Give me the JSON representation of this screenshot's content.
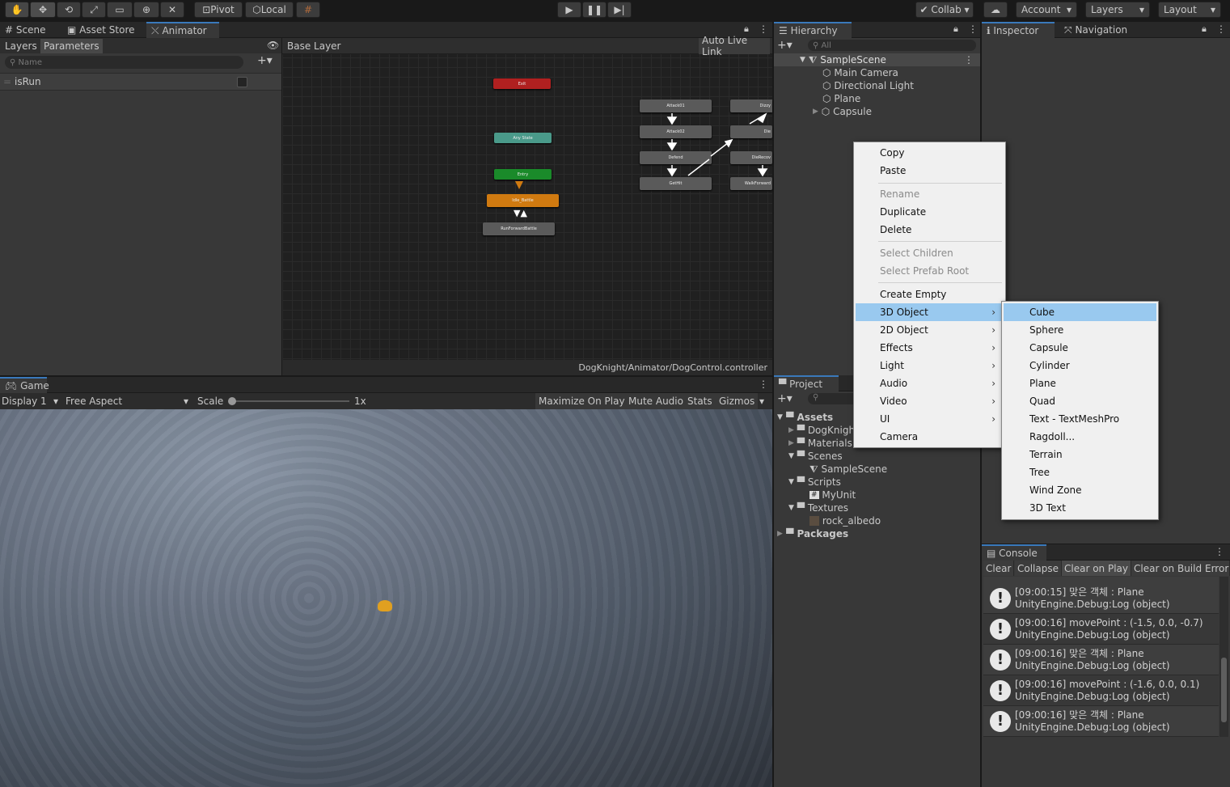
{
  "toolbar": {
    "pivot": "Pivot",
    "local": "Local",
    "collab": "Collab",
    "account": "Account",
    "layers": "Layers",
    "layout": "Layout"
  },
  "tabs_top": {
    "scene": "Scene",
    "asset_store": "Asset Store",
    "animator": "Animator"
  },
  "animator": {
    "sub_tabs": [
      "Layers",
      "Parameters"
    ],
    "name_placeholder": "Name",
    "param": "isRun",
    "breadcrumb": "Base Layer",
    "auto_live_link": "Auto Live Link",
    "path": "DogKnight/Animator/DogControl.controller",
    "nodes": {
      "exit": "Exit",
      "any": "Any State",
      "entry": "Entry",
      "idle": "Idle_Battle",
      "run": "RunForwardBattle",
      "atk1": "Attack01",
      "atk2": "Attack02",
      "defend": "Defend",
      "gethit": "GetHit",
      "dizzy": "Dizzy",
      "die": "Die",
      "dierecover": "DieRecov",
      "walk": "WalkForward"
    }
  },
  "game": {
    "tab": "Game",
    "display": "Display 1",
    "aspect": "Free Aspect",
    "scale_label": "Scale",
    "scale_value": "1x",
    "maximize": "Maximize On Play",
    "mute": "Mute Audio",
    "stats": "Stats",
    "gizmos": "Gizmos"
  },
  "hierarchy": {
    "tab": "Hierarchy",
    "search_placeholder": "All",
    "scene": "SampleScene",
    "items": [
      "Main Camera",
      "Directional Light",
      "Plane",
      "Capsule"
    ]
  },
  "inspector": {
    "tab": "Inspector",
    "nav_tab": "Navigation"
  },
  "project": {
    "tab": "Project",
    "assets": "Assets",
    "items": [
      "DogKnight",
      "Materials",
      "Scenes",
      "SampleScene",
      "Scripts",
      "MyUnit",
      "Textures",
      "rock_albedo",
      "Packages"
    ]
  },
  "context_menu": {
    "items": [
      "Copy",
      "Paste",
      "Rename",
      "Duplicate",
      "Delete",
      "Select Children",
      "Select Prefab Root",
      "Create Empty",
      "3D Object",
      "2D Object",
      "Effects",
      "Light",
      "Audio",
      "Video",
      "UI",
      "Camera"
    ]
  },
  "submenu": {
    "items": [
      "Cube",
      "Sphere",
      "Capsule",
      "Cylinder",
      "Plane",
      "Quad",
      "Text - TextMeshPro",
      "Ragdoll...",
      "Terrain",
      "Tree",
      "Wind Zone",
      "3D Text"
    ]
  },
  "console": {
    "tab": "Console",
    "buttons": [
      "Clear",
      "Collapse",
      "Clear on Play",
      "Clear on Build",
      "Error"
    ],
    "logs": [
      {
        "line1": "[09:00:15] 맞은 객체 : Plane",
        "line2": "UnityEngine.Debug:Log (object)"
      },
      {
        "line1": "[09:00:16] movePoint : (-1.5, 0.0, -0.7)",
        "line2": "UnityEngine.Debug:Log (object)"
      },
      {
        "line1": "[09:00:16] 맞은 객체 : Plane",
        "line2": "UnityEngine.Debug:Log (object)"
      },
      {
        "line1": "[09:00:16] movePoint : (-1.6, 0.0, 0.1)",
        "line2": "UnityEngine.Debug:Log (object)"
      },
      {
        "line1": "[09:00:16] 맞은 객체 : Plane",
        "line2": "UnityEngine.Debug:Log (object)"
      }
    ]
  }
}
